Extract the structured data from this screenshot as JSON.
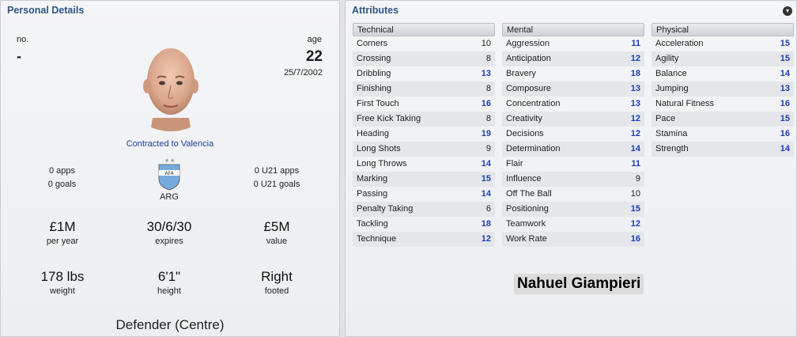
{
  "personal": {
    "title": "Personal Details",
    "no_label": "no.",
    "no_value": "-",
    "age_label": "age",
    "age_value": "22",
    "dob": "25/7/2002",
    "contract": "Contracted to Valencia",
    "apps": "0 apps",
    "goals": "0 goals",
    "nation": "ARG",
    "u21_apps": "0 U21 apps",
    "u21_goals": "0 U21 goals",
    "wage": "£1M",
    "wage_label": "per year",
    "expires": "30/6/30",
    "expires_label": "expires",
    "value": "£5M",
    "value_label": "value",
    "weight": "178 lbs",
    "weight_label": "weight",
    "height": "6'1\"",
    "height_label": "height",
    "footed": "Right",
    "footed_label": "footed",
    "position": "Defender (Centre)"
  },
  "attributes": {
    "title": "Attributes",
    "player_name": "Nahuel Giampieri",
    "colors": {
      "highlight": "#1a3fb8",
      "normal": "#222222",
      "title": "#2f5685"
    },
    "technical": {
      "header": "Technical",
      "rows": [
        {
          "name": "Corners",
          "value": "10",
          "hi": false
        },
        {
          "name": "Crossing",
          "value": "8",
          "hi": false
        },
        {
          "name": "Dribbling",
          "value": "13",
          "hi": true
        },
        {
          "name": "Finishing",
          "value": "8",
          "hi": false
        },
        {
          "name": "First Touch",
          "value": "16",
          "hi": true
        },
        {
          "name": "Free Kick Taking",
          "value": "8",
          "hi": false
        },
        {
          "name": "Heading",
          "value": "19",
          "hi": true
        },
        {
          "name": "Long Shots",
          "value": "9",
          "hi": false
        },
        {
          "name": "Long Throws",
          "value": "14",
          "hi": true
        },
        {
          "name": "Marking",
          "value": "15",
          "hi": true
        },
        {
          "name": "Passing",
          "value": "14",
          "hi": true
        },
        {
          "name": "Penalty Taking",
          "value": "6",
          "hi": false
        },
        {
          "name": "Tackling",
          "value": "18",
          "hi": true
        },
        {
          "name": "Technique",
          "value": "12",
          "hi": true
        }
      ]
    },
    "mental": {
      "header": "Mental",
      "rows": [
        {
          "name": "Aggression",
          "value": "11",
          "hi": true
        },
        {
          "name": "Anticipation",
          "value": "12",
          "hi": true
        },
        {
          "name": "Bravery",
          "value": "18",
          "hi": true
        },
        {
          "name": "Composure",
          "value": "13",
          "hi": true
        },
        {
          "name": "Concentration",
          "value": "13",
          "hi": true
        },
        {
          "name": "Creativity",
          "value": "12",
          "hi": true
        },
        {
          "name": "Decisions",
          "value": "12",
          "hi": true
        },
        {
          "name": "Determination",
          "value": "14",
          "hi": true
        },
        {
          "name": "Flair",
          "value": "11",
          "hi": true
        },
        {
          "name": "Influence",
          "value": "9",
          "hi": false
        },
        {
          "name": "Off The Ball",
          "value": "10",
          "hi": false
        },
        {
          "name": "Positioning",
          "value": "15",
          "hi": true
        },
        {
          "name": "Teamwork",
          "value": "12",
          "hi": true
        },
        {
          "name": "Work Rate",
          "value": "16",
          "hi": true
        }
      ]
    },
    "physical": {
      "header": "Physical",
      "rows": [
        {
          "name": "Acceleration",
          "value": "15",
          "hi": true
        },
        {
          "name": "Agility",
          "value": "15",
          "hi": true
        },
        {
          "name": "Balance",
          "value": "14",
          "hi": true
        },
        {
          "name": "Jumping",
          "value": "13",
          "hi": true
        },
        {
          "name": "Natural Fitness",
          "value": "16",
          "hi": true
        },
        {
          "name": "Pace",
          "value": "15",
          "hi": true
        },
        {
          "name": "Stamina",
          "value": "16",
          "hi": true
        },
        {
          "name": "Strength",
          "value": "14",
          "hi": true
        }
      ]
    }
  }
}
